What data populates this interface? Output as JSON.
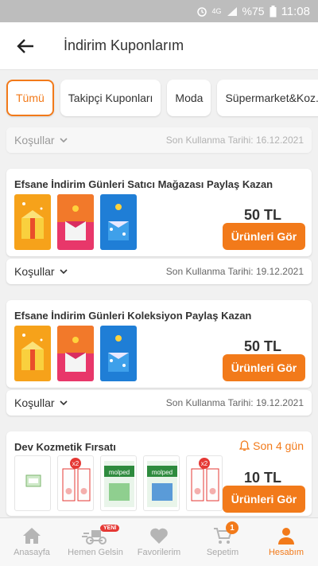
{
  "status_bar": {
    "battery": "%75",
    "time": "11:08",
    "network": "4G"
  },
  "header": {
    "title": "İndirim Kuponlarım"
  },
  "tabs": [
    {
      "label": "Tümü"
    },
    {
      "label": "Takipçi Kuponları"
    },
    {
      "label": "Moda"
    },
    {
      "label": "Süpermarket&Koz..."
    }
  ],
  "conditions_label": "Koşullar",
  "first_conditions": {
    "date": "Son Kullanma Tarihi: 16.12.2021"
  },
  "coupons": [
    {
      "title": "Efsane İndirim Günleri Satıcı Mağazası Paylaş Kazan",
      "amount": "50 TL",
      "button": "Ürünleri Gör",
      "date": "Son Kullanma Tarihi: 19.12.2021"
    },
    {
      "title": "Efsane İndirim Günleri Koleksiyon Paylaş Kazan",
      "amount": "50 TL",
      "button": "Ürünleri Gör",
      "date": "Son Kullanma Tarihi: 19.12.2021"
    },
    {
      "title": "Dev Kozmetik Fırsatı",
      "amount": "10 TL",
      "button": "Ürünleri Gör",
      "days_left": "Son 4 gün",
      "badges": [
        "x2",
        "x2"
      ]
    }
  ],
  "bottom_nav": [
    {
      "label": "Anasayfa",
      "icon": "home-icon"
    },
    {
      "label": "Hemen Gelsin",
      "icon": "delivery-icon",
      "badge": "YENİ"
    },
    {
      "label": "Favorilerim",
      "icon": "heart-icon"
    },
    {
      "label": "Sepetim",
      "icon": "cart-icon",
      "badge": "1"
    },
    {
      "label": "Hesabım",
      "icon": "user-icon"
    }
  ],
  "colors": {
    "accent": "#f27a1a",
    "background": "#f1f1f1",
    "status_bar": "#bdbdbd"
  }
}
